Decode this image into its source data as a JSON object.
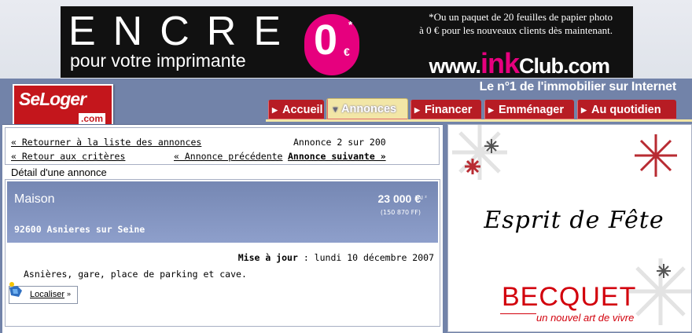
{
  "banner": {
    "headline": "ENCRE",
    "subline": "pour votre imprimante",
    "zero": "0",
    "zero_star": "*",
    "euro": "€",
    "promo_line1": "*Ou un paquet de 20 feuilles de papier photo",
    "promo_line2": "à 0 € pour les nouveaux clients dès maintenant.",
    "url_prefix": "www.",
    "url_brand": "ink",
    "url_suffix": "Club.com"
  },
  "header": {
    "logo_main": "SeLoger",
    "logo_com": ".com",
    "tagline": "Le n°1 de l'immobilier sur Internet",
    "tabs": [
      {
        "label": "Accueil",
        "active": false
      },
      {
        "label": "Annonces",
        "active": true
      },
      {
        "label": "Financer",
        "active": false
      },
      {
        "label": "Emménager",
        "active": false
      },
      {
        "label": "Au quotidien",
        "active": false
      }
    ]
  },
  "nav": {
    "back_list": "« Retourner à la liste des annonces",
    "counter": "Annonce 2 sur 200",
    "back_criteria": "« Retour aux critères",
    "prev": "« Annonce précédente",
    "next": "Annonce suivante »"
  },
  "detail": {
    "section_title": "Détail d'une annonce",
    "type": "Maison",
    "price": "23 000 €",
    "fai": "FAI ²",
    "francs": "(150 870 FF)",
    "city": "92600 Asnieres sur Seine",
    "update_label": "Mise à jour",
    "update_value": ": lundi 10 décembre 2007",
    "description": "Asnières, gare, place de parking et cave.",
    "localiser": "Localiser",
    "localiser_arrow": "»"
  },
  "side_ad": {
    "headline": "Esprit de Fête",
    "brand": "BECQUET",
    "brand_sub": "un nouvel art de vivre"
  },
  "colors": {
    "page_bg": "#7283a9",
    "brand_red": "#c4161c",
    "tab_red": "#b71c24",
    "tab_active": "#f2e6a6",
    "listing_blue": "#7587b3",
    "ink_pink": "#e6007e"
  }
}
